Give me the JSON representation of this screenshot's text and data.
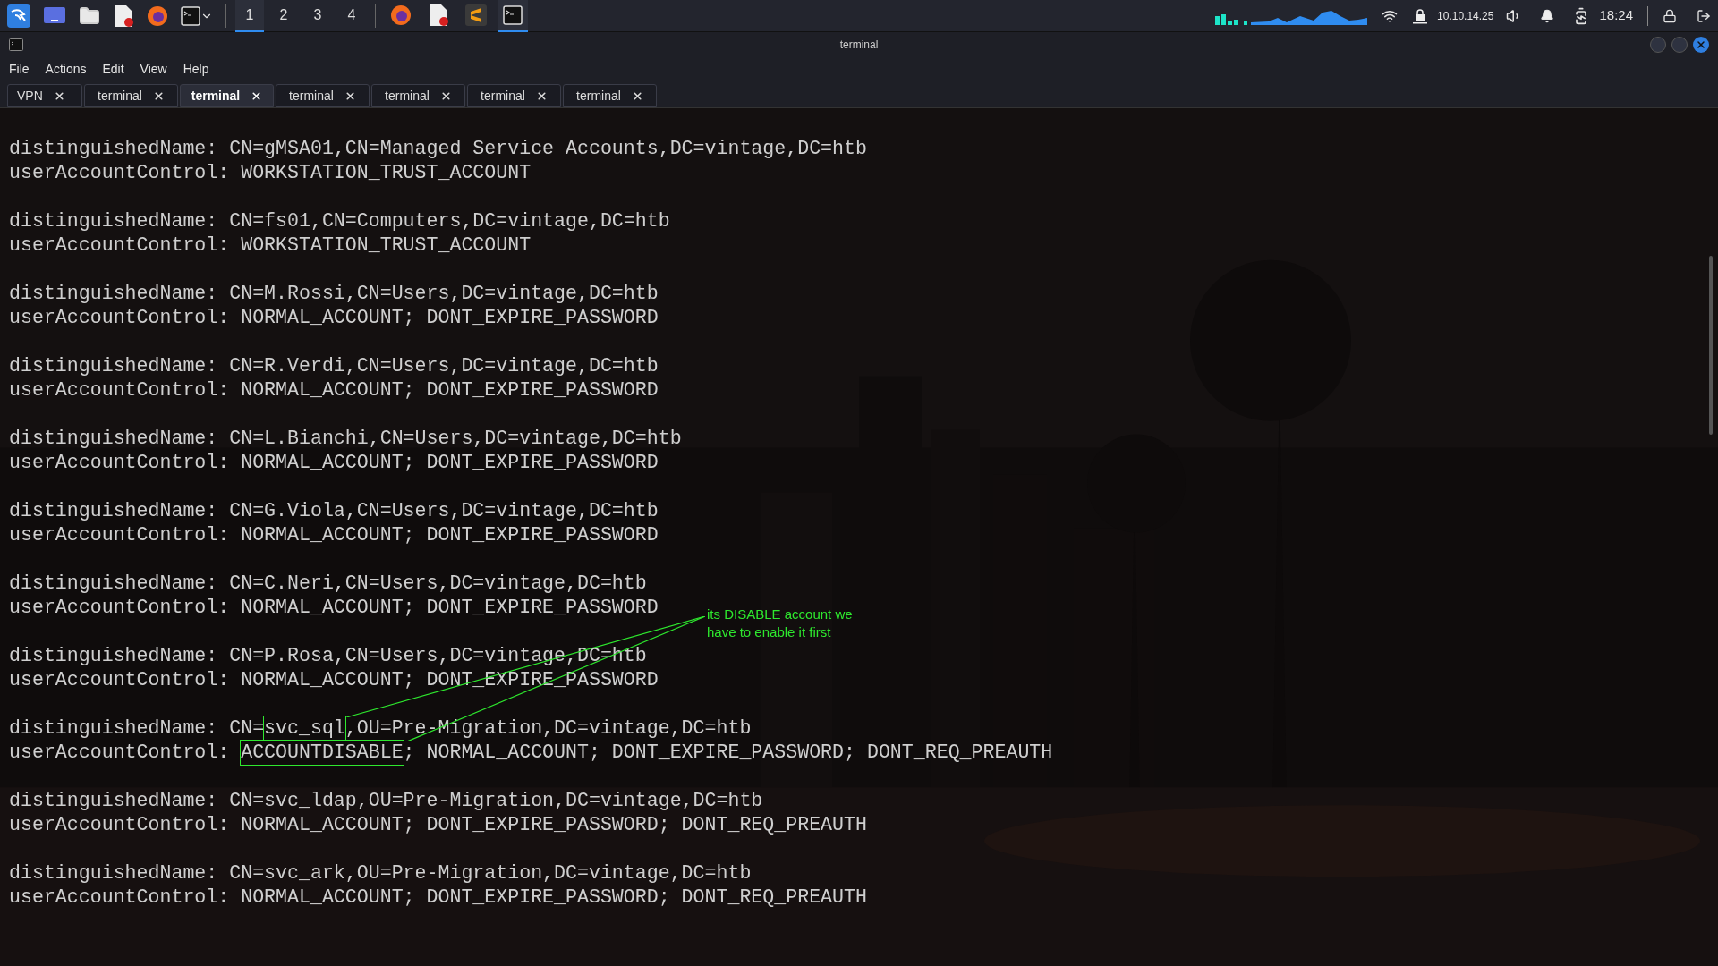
{
  "panel": {
    "apps": [
      {
        "kind": "kali"
      },
      {
        "kind": "desktop"
      },
      {
        "kind": "files"
      },
      {
        "kind": "editor"
      },
      {
        "kind": "firefox"
      },
      {
        "kind": "terminal"
      }
    ],
    "workspaces": [
      {
        "label": "1",
        "selected": true
      },
      {
        "label": "2",
        "selected": false
      },
      {
        "label": "3",
        "selected": false
      },
      {
        "label": "4",
        "selected": false
      }
    ],
    "tasks": [
      {
        "kind": "firefox",
        "selected": false
      },
      {
        "kind": "editor",
        "selected": false
      },
      {
        "kind": "sublime",
        "selected": false
      },
      {
        "kind": "terminal",
        "selected": true
      }
    ],
    "ip": "10.10.14.25",
    "clock": "18:24"
  },
  "window": {
    "title": "terminal"
  },
  "menu": [
    "File",
    "Actions",
    "Edit",
    "View",
    "Help"
  ],
  "tabs": [
    {
      "label": "VPN",
      "selected": false
    },
    {
      "label": "terminal",
      "selected": false
    },
    {
      "label": "terminal",
      "selected": true
    },
    {
      "label": "terminal",
      "selected": false
    },
    {
      "label": "terminal",
      "selected": false
    },
    {
      "label": "terminal",
      "selected": false
    },
    {
      "label": "terminal",
      "selected": false
    }
  ],
  "terminal": {
    "entries": [
      {
        "dn": [
          {
            "text": "distinguishedName: CN=gMSA01,CN=Managed Service Accounts,DC=vintage,DC=htb",
            "boxed": false
          }
        ],
        "uac": [
          {
            "text": "userAccountControl: WORKSTATION_TRUST_ACCOUNT",
            "boxed": false
          }
        ]
      },
      {
        "dn": [
          {
            "text": "distinguishedName: CN=fs01,CN=Computers,DC=vintage,DC=htb",
            "boxed": false
          }
        ],
        "uac": [
          {
            "text": "userAccountControl: WORKSTATION_TRUST_ACCOUNT",
            "boxed": false
          }
        ]
      },
      {
        "dn": [
          {
            "text": "distinguishedName: CN=M.Rossi,CN=Users,DC=vintage,DC=htb",
            "boxed": false
          }
        ],
        "uac": [
          {
            "text": "userAccountControl: NORMAL_ACCOUNT; DONT_EXPIRE_PASSWORD",
            "boxed": false
          }
        ]
      },
      {
        "dn": [
          {
            "text": "distinguishedName: CN=R.Verdi,CN=Users,DC=vintage,DC=htb",
            "boxed": false
          }
        ],
        "uac": [
          {
            "text": "userAccountControl: NORMAL_ACCOUNT; DONT_EXPIRE_PASSWORD",
            "boxed": false
          }
        ]
      },
      {
        "dn": [
          {
            "text": "distinguishedName: CN=L.Bianchi,CN=Users,DC=vintage,DC=htb",
            "boxed": false
          }
        ],
        "uac": [
          {
            "text": "userAccountControl: NORMAL_ACCOUNT; DONT_EXPIRE_PASSWORD",
            "boxed": false
          }
        ]
      },
      {
        "dn": [
          {
            "text": "distinguishedName: CN=G.Viola,CN=Users,DC=vintage,DC=htb",
            "boxed": false
          }
        ],
        "uac": [
          {
            "text": "userAccountControl: NORMAL_ACCOUNT; DONT_EXPIRE_PASSWORD",
            "boxed": false
          }
        ]
      },
      {
        "dn": [
          {
            "text": "distinguishedName: CN=C.Neri,CN=Users,DC=vintage,DC=htb",
            "boxed": false
          }
        ],
        "uac": [
          {
            "text": "userAccountControl: NORMAL_ACCOUNT; DONT_EXPIRE_PASSWORD",
            "boxed": false
          }
        ]
      },
      {
        "dn": [
          {
            "text": "distinguishedName: CN=P.Rosa,CN=Users,DC=vintage,DC=htb",
            "boxed": false
          }
        ],
        "uac": [
          {
            "text": "userAccountControl: NORMAL_ACCOUNT; DONT_EXPIRE_PASSWORD",
            "boxed": false
          }
        ]
      },
      {
        "dn": [
          {
            "text": "distinguishedName: CN=",
            "boxed": false
          },
          {
            "text": "svc_sql",
            "boxed": true
          },
          {
            "text": ",OU=Pre-Migration,DC=vintage,DC=htb",
            "boxed": false
          }
        ],
        "uac": [
          {
            "text": "userAccountControl: ",
            "boxed": false
          },
          {
            "text": "ACCOUNTDISABLE",
            "boxed": true
          },
          {
            "text": "; NORMAL_ACCOUNT; DONT_EXPIRE_PASSWORD; DONT_REQ_PREAUTH",
            "boxed": false
          }
        ]
      },
      {
        "dn": [
          {
            "text": "distinguishedName: CN=svc_ldap,OU=Pre-Migration,DC=vintage,DC=htb",
            "boxed": false
          }
        ],
        "uac": [
          {
            "text": "userAccountControl: NORMAL_ACCOUNT; DONT_EXPIRE_PASSWORD; DONT_REQ_PREAUTH",
            "boxed": false
          }
        ]
      },
      {
        "dn": [
          {
            "text": "distinguishedName: CN=svc_ark,OU=Pre-Migration,DC=vintage,DC=htb",
            "boxed": false
          }
        ],
        "uac": [
          {
            "text": "userAccountControl: NORMAL_ACCOUNT; DONT_EXPIRE_PASSWORD; DONT_REQ_PREAUTH",
            "boxed": false
          }
        ]
      }
    ]
  },
  "annotation": {
    "text": "its DISABLE account we have to enable it first"
  }
}
